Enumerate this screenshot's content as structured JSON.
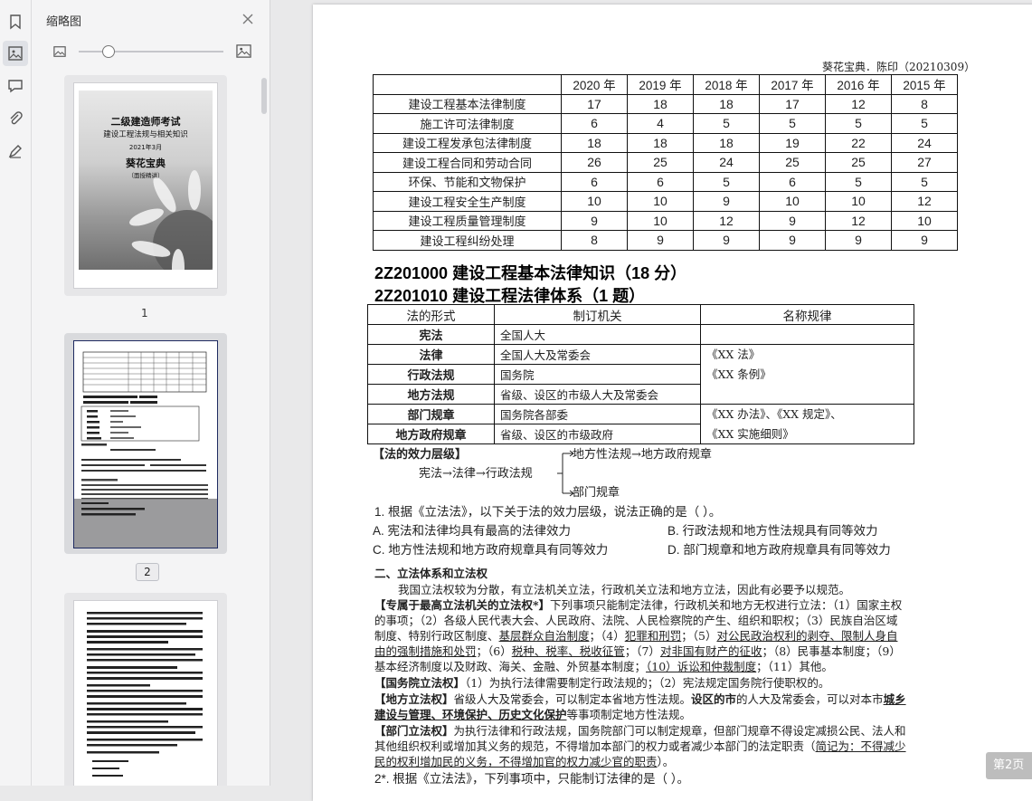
{
  "panel": {
    "title": "缩略图",
    "pages": [
      {
        "num": "1",
        "cover_title": "二级建造师考试",
        "cover_subtitle": "建设工程法规与相关知识",
        "cover_date": "2021年3月",
        "cover_brand": "葵花宝典",
        "cover_note": "（面授精讲）"
      },
      {
        "num": "2"
      }
    ],
    "zoom_fraction": 0.2
  },
  "document": {
    "header": "葵花宝典．陈印（20210309）",
    "stat_table": {
      "years": [
        "2020 年",
        "2019 年",
        "2018 年",
        "2017 年",
        "2016 年",
        "2015 年"
      ],
      "rows": [
        {
          "label": "建设工程基本法律制度",
          "values": [
            "17",
            "18",
            "18",
            "17",
            "12",
            "8"
          ]
        },
        {
          "label": "施工许可法律制度",
          "values": [
            "6",
            "4",
            "5",
            "5",
            "5",
            "5"
          ]
        },
        {
          "label": "建设工程发承包法律制度",
          "values": [
            "18",
            "18",
            "18",
            "19",
            "22",
            "24"
          ]
        },
        {
          "label": "建设工程合同和劳动合同",
          "values": [
            "26",
            "25",
            "24",
            "25",
            "25",
            "27"
          ]
        },
        {
          "label": "环保、节能和文物保护",
          "values": [
            "6",
            "6",
            "5",
            "6",
            "5",
            "5"
          ]
        },
        {
          "label": "建设工程安全生产制度",
          "values": [
            "10",
            "10",
            "9",
            "10",
            "10",
            "12"
          ]
        },
        {
          "label": "建设工程质量管理制度",
          "values": [
            "9",
            "10",
            "12",
            "9",
            "12",
            "10"
          ]
        },
        {
          "label": "建设工程纠纷处理",
          "values": [
            "8",
            "9",
            "9",
            "9",
            "9",
            "9"
          ]
        }
      ]
    },
    "heading1": "2Z201000  建设工程基本法律知识（18 分）",
    "heading2": "2Z201010  建设工程法律体系（1 题）",
    "law_table": {
      "headers": [
        "法的形式",
        "制订机关",
        "名称规律"
      ],
      "rows": [
        {
          "form": "宪法",
          "org": "全国人大",
          "norm": ""
        },
        {
          "form": "法律",
          "org": "全国人大及常委会",
          "norm": "《XX 法》"
        },
        {
          "form": "行政法规",
          "org": "国务院",
          "norm": "《XX 条例》"
        },
        {
          "form": "地方法规",
          "org": "省级、设区的市级人大及常委会",
          "norm": ""
        },
        {
          "form": "部门规章",
          "org": "国务院各部委",
          "norm": "《XX 办法》、《XX 规定》、"
        },
        {
          "form": "地方政府规章",
          "org": "省级、设区的市级政府",
          "norm": "《XX 实施细则》"
        }
      ]
    },
    "hierarchy": {
      "title": "【法的效力层级】",
      "chain": "宪法→法律→行政法规",
      "upper": "地方性法规→地方政府规章",
      "lower": "部门规章"
    },
    "q1": {
      "stem": "1.  根据《立法法》，以下关于法的效力层级，说法正确的是（     ）。",
      "a": "A.  宪法和法律均具有最高的法律效力",
      "b": "B.  行政法规和地方性法规具有同等效力",
      "c": "C.  地方性法规和地方政府规章具有同等效力",
      "d": "D.  部门规章和地方政府规章具有同等效力"
    },
    "section2": {
      "title": "二、立法体系和立法权",
      "intro": "我国立法权较为分散，有立法机关立法，行政机关立法和地方立法，因此有必要予以规范。",
      "exclusive_head": "【专属于最高立法机关的立法权*】",
      "exclusive_1": "下列事项只能制定法律，行政机关和地方无权进行立法：（1）国家主权",
      "exclusive_2": "的事项；（2）各级人民代表大会、人民政府、法院、人民检察院的产生、组织和职权；（3）民族自治区域",
      "exclusive_3a": "制度、特别行政区制度、",
      "exclusive_3b": "基层群众自治制度",
      "exclusive_3c": "；（4）",
      "exclusive_3d": "犯罪和刑罚",
      "exclusive_3e": "；（5）",
      "exclusive_3f": "对公民政治权利的剥夺、限制人身自",
      "exclusive_4a": "由的强制措施和处罚",
      "exclusive_4b": "；（6）",
      "exclusive_4c": "税种、税率、税收征管",
      "exclusive_4d": "；（7）",
      "exclusive_4e": "对非国有财产的征收",
      "exclusive_4f": "；（8）民事基本制度；（9）",
      "exclusive_5a": "基本经济制度以及财政、海关、金融、外贸基本制度；",
      "exclusive_5b": "（10）诉讼和仲裁制度",
      "exclusive_5c": "；（11）其他。",
      "state_head": "【国务院立法权】",
      "state_text": "（1）为执行法律需要制定行政法规的；（2）宪法规定国务院行使职权的。",
      "local_head": "【地方立法权】",
      "local_text1": "省级人大及常委会，可以制定本省地方性法规。",
      "local_text1b": "设区的市",
      "local_text1c": "的人大及常委会，可以对本市",
      "local_text1d": "城乡",
      "local_text2a": "建设与管理、环境保护、历史文化保护",
      "local_text2b": "等事项制定地方性法规。",
      "dept_head": "【部门立法权】",
      "dept_text1": "为执行法律和行政法规，国务院部门可以制定规章，但部门规章不得设定减损公民、法人和",
      "dept_text2a": "其他组织权利或增加其义务的规范，不得增加本部门的权力或者减少本部门的法定职责（",
      "dept_text2b": "简记为：不得减少",
      "dept_text3": "民的权利增加民的义务，不得增加官的权力减少官的职责",
      "dept_text3b": "）。",
      "q2": "2*.  根据《立法法》，下列事项中，只能制订法律的是（        ）。"
    }
  },
  "next_button": "第2页"
}
